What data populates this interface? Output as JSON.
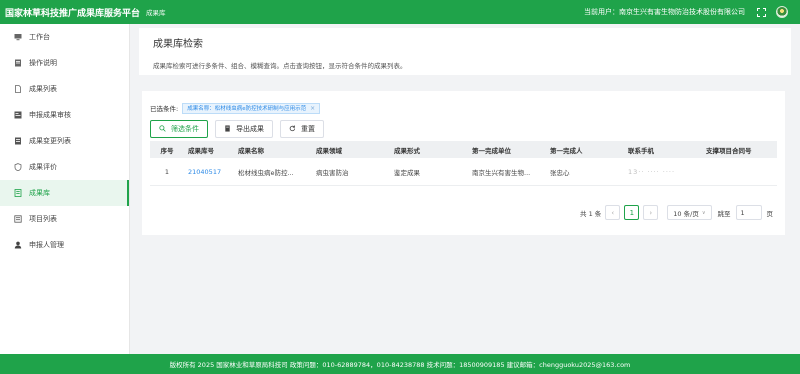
{
  "header": {
    "brand": "国家林草科技推广成果库服务平台",
    "breadcrumb": "成果库",
    "current_user_label": "当前用户：南京生兴有害生物防治技术股份有限公司",
    "accent_color": "#1fa34a"
  },
  "sidebar": {
    "items": [
      {
        "label": "工作台",
        "icon": "monitor-icon",
        "active": false
      },
      {
        "label": "操作说明",
        "icon": "manual-icon",
        "active": false
      },
      {
        "label": "成果列表",
        "icon": "document-icon",
        "active": false
      },
      {
        "label": "申报成果审核",
        "icon": "audit-icon",
        "active": false
      },
      {
        "label": "成果变更列表",
        "icon": "change-list-icon",
        "active": false
      },
      {
        "label": "成果评价",
        "icon": "evaluation-icon",
        "active": false
      },
      {
        "label": "成果库",
        "icon": "library-icon",
        "active": true
      },
      {
        "label": "项目列表",
        "icon": "project-list-icon",
        "active": false
      },
      {
        "label": "申报人管理",
        "icon": "user-icon",
        "active": false
      }
    ]
  },
  "page": {
    "title": "成果库检索",
    "description": "成果库检索可进行多条件、组合、模糊查询。点击查询按钮，显示符合条件的成果列表。"
  },
  "filters": {
    "label": "已选条件:",
    "tag": "成果名称：松材线虫病e防控技术研制与应用示范"
  },
  "toolbar": {
    "filter_label": "筛选条件",
    "export_label": "导出成果",
    "reset_label": "重置"
  },
  "table": {
    "columns": [
      "序号",
      "成果库号",
      "成果名称",
      "成果领域",
      "成果形式",
      "第一完成单位",
      "第一完成人",
      "联系手机",
      "支撑项目合同号"
    ],
    "rows": [
      [
        "1",
        "21040517",
        "松材线虫病e防控...",
        "病虫害防治",
        "鉴定成果",
        "南京生兴有害生物...",
        "张忠心",
        "13·· ···· ····",
        ""
      ]
    ]
  },
  "pagination": {
    "total_label": "共 1 条",
    "prev": "‹",
    "current_page": "1",
    "next": "›",
    "page_size": "10 条/页",
    "jump_label": "跳至",
    "jump_value": "1",
    "page_suffix": "页"
  },
  "footer": {
    "text": "版权所有 2025 国家林业和草原局科技司  政策问题：010-62889784，010-84238788  技术问题：18500909185  建议邮箱：chengguoku2025@163.com"
  }
}
